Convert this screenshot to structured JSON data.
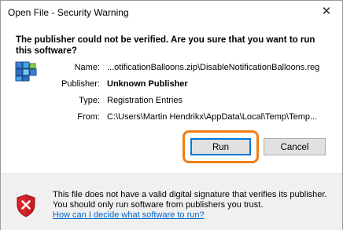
{
  "window": {
    "title": "Open File - Security Warning",
    "close_glyph": "✕"
  },
  "question": "The publisher could not be verified. Are you sure that you want to run this software?",
  "details": {
    "name_label": "Name:",
    "name_value": "...otificationBalloons.zip\\DisableNotificationBalloons.reg",
    "publisher_label": "Publisher:",
    "publisher_value": "Unknown Publisher",
    "type_label": "Type:",
    "type_value": "Registration Entries",
    "from_label": "From:",
    "from_value": "C:\\Users\\Martin Hendrikx\\AppData\\Local\\Temp\\Temp...",
    "file_icon": "registry-file-icon"
  },
  "buttons": {
    "run": "Run",
    "cancel": "Cancel"
  },
  "footer": {
    "warning_text": "This file does not have a valid digital signature that verifies its publisher. You should only run software from publishers you trust.",
    "link_text": "How can I decide what software to run?",
    "icon": "shield-error-icon"
  },
  "colors": {
    "highlight": "#f07d16",
    "link": "#0066cc",
    "shield_red": "#d9232d",
    "default_button_border": "#0078d7"
  }
}
